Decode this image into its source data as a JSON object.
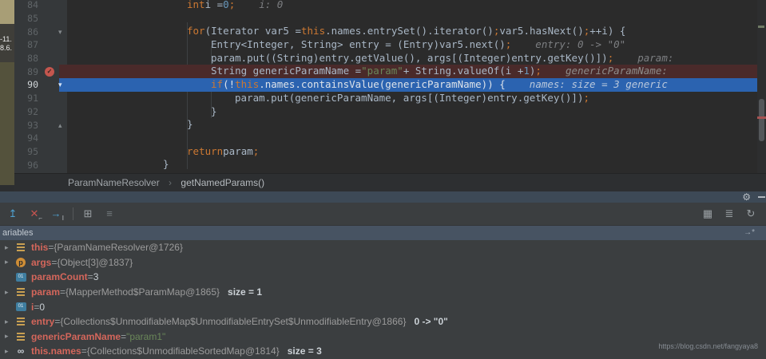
{
  "colors": {
    "breakpoint_line": "#4a2a2a",
    "execution_line": "#2b63b0",
    "keyword": "#cc7832",
    "string": "#6a8759",
    "number": "#6897bb",
    "variable_name": "#d4665b",
    "editor_bg": "#2b2b2b",
    "panel_header_bg": "#475362"
  },
  "left_strip": {
    "labels": [
      "-11.",
      "8.6."
    ]
  },
  "editor": {
    "lines": [
      {
        "num": "84",
        "indent": 20,
        "tokens": [
          [
            "int",
            "kw"
          ],
          [
            " i = ",
            "pl"
          ],
          [
            "0",
            "num"
          ],
          [
            ";",
            "sc"
          ]
        ],
        "hint": "i: 0"
      },
      {
        "num": "85"
      },
      {
        "num": "86",
        "indent": 20,
        "fold": "down",
        "tokens": [
          [
            "for",
            "kw"
          ],
          [
            "(Iterator var5 = ",
            "pl"
          ],
          [
            "this",
            "kw"
          ],
          [
            ".names.entrySet().iterator()",
            "pl"
          ],
          [
            ";",
            "sc"
          ],
          [
            " var5.hasNext()",
            "pl"
          ],
          [
            ";",
            "sc"
          ],
          [
            " ++i) {",
            "pl"
          ]
        ]
      },
      {
        "num": "87",
        "indent": 24,
        "tokens": [
          [
            "Entry<Integer, String> entry = (Entry)var5.next()",
            "pl"
          ],
          [
            ";",
            "sc"
          ]
        ],
        "hint": "entry: 0 -> \"0\""
      },
      {
        "num": "88",
        "indent": 24,
        "tokens": [
          [
            "param.put((String)entry.getValue(), args[(Integer)entry.getKey()])",
            "pl"
          ],
          [
            ";",
            "sc"
          ]
        ],
        "hint": "param:"
      },
      {
        "num": "89",
        "indent": 24,
        "bg": "breakpoint",
        "breakpoint": true,
        "tokens": [
          [
            "String genericParamName = ",
            "pl"
          ],
          [
            "\"param\"",
            "str"
          ],
          [
            " + String.valueOf(i + ",
            "pl"
          ],
          [
            "1",
            "num"
          ],
          [
            ")",
            "pl"
          ],
          [
            ";",
            "sc"
          ]
        ],
        "hint": "genericParamName:"
      },
      {
        "num": "90",
        "indent": 24,
        "bg": "exec",
        "current": true,
        "fold": "down",
        "tokens": [
          [
            "if",
            "kw"
          ],
          [
            " (!",
            "pl"
          ],
          [
            "this",
            "kw"
          ],
          [
            ".names.containsValue(genericParamName)) {",
            "pl"
          ]
        ],
        "hint": "names:  size = 3  generic"
      },
      {
        "num": "91",
        "indent": 28,
        "tokens": [
          [
            "param.put(genericParamName, args[(Integer)entry.getKey()])",
            "pl"
          ],
          [
            ";",
            "sc"
          ]
        ]
      },
      {
        "num": "92",
        "indent": 24,
        "tokens": [
          [
            "}",
            "pl"
          ]
        ]
      },
      {
        "num": "93",
        "indent": 20,
        "fold": "up",
        "tokens": [
          [
            "}",
            "pl"
          ]
        ]
      },
      {
        "num": "94"
      },
      {
        "num": "95",
        "indent": 20,
        "tokens": [
          [
            "return",
            "kw"
          ],
          [
            " param",
            "pl"
          ],
          [
            ";",
            "sc"
          ]
        ]
      },
      {
        "num": "96",
        "indent": 16,
        "tokens": [
          [
            "}",
            "pl"
          ]
        ]
      }
    ]
  },
  "breadcrumb": {
    "items": [
      "ParamNameResolver",
      "getNamedParams()"
    ],
    "separator": "›"
  },
  "debug_header": {
    "icons": [
      {
        "name": "settings-gear-icon",
        "glyph": "⚙"
      },
      {
        "name": "hide-panel-icon",
        "glyph": "—"
      }
    ]
  },
  "toolbar": {
    "left_icons": [
      {
        "name": "arrow-up-icon",
        "glyph": "↥",
        "color": "#4fa0cf"
      },
      {
        "name": "remove-x-icon",
        "glyph": "✕",
        "color": "#c75450",
        "sub": "⌐",
        "subcolor": "#9aa0a4"
      },
      {
        "name": "arrow-i-icon",
        "glyph": "→",
        "color": "#4fa0cf",
        "sub": "I",
        "subcolor": "#b9bfc4"
      },
      {
        "sep": true
      },
      {
        "name": "grid-view-icon",
        "glyph": "⊞",
        "color": "#9aa0a4"
      },
      {
        "name": "list-view-icon",
        "glyph": "≡",
        "color": "#73797c"
      }
    ],
    "right_icons": [
      {
        "name": "filmstrip-icon",
        "glyph": "▦",
        "color": "#9aa0a4"
      },
      {
        "name": "stack-icon",
        "glyph": "≣",
        "color": "#9aa0a4"
      },
      {
        "name": "refresh-gauge-icon",
        "glyph": "↻",
        "color": "#9aa0a4"
      }
    ]
  },
  "variables_panel": {
    "title": "ariables",
    "nav_icon_glyph": "→*",
    "rows": [
      {
        "expand": true,
        "icon": "value",
        "name": "this",
        "eq": " = ",
        "value": "{ParamNameResolver@1726}"
      },
      {
        "expand": true,
        "icon": "parameter",
        "name": "args",
        "eq": " = ",
        "value": "{Object[3]@1837}"
      },
      {
        "expand": false,
        "icon": "primitive",
        "name": "paramCount",
        "eq": " = ",
        "value_plain": "3"
      },
      {
        "expand": true,
        "icon": "value",
        "name": "param",
        "eq": " = ",
        "value": "{MapperMethod$ParamMap@1865}",
        "extra": "size = 1"
      },
      {
        "expand": false,
        "icon": "primitive",
        "name": "i",
        "eq": " = ",
        "value_plain": "0"
      },
      {
        "expand": true,
        "icon": "value",
        "name": "entry",
        "eq": " = ",
        "value": "{Collections$UnmodifiableMap$UnmodifiableEntrySet$UnmodifiableEntry@1866}",
        "extra": "0 -> \"0\""
      },
      {
        "expand": true,
        "icon": "value",
        "name": "genericParamName",
        "eq": " = ",
        "value_string": "\"param1\""
      },
      {
        "expand": true,
        "icon": "watch",
        "name": "this.names",
        "eq": " = ",
        "value": "{Collections$UnmodifiableSortedMap@1814}",
        "extra": "size = 3"
      }
    ],
    "icon_primitive_text": "01",
    "icon_parameter_text": "p",
    "icon_watch_glyph": "∞",
    "arrow_glyph": "▸"
  },
  "watermark": "https://blog.csdn.net/fangyaya8"
}
